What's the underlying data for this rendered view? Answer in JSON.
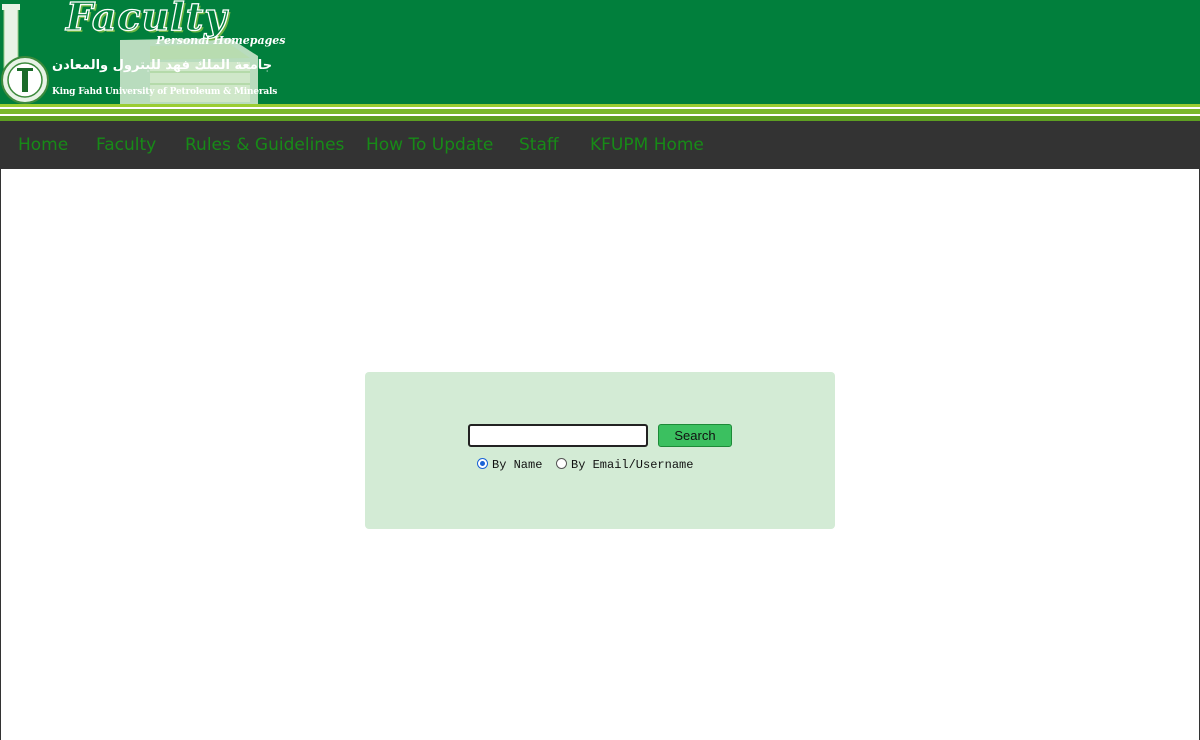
{
  "header": {
    "logo_title": "Faculty",
    "logo_subtitle": "Personal Homepages",
    "logo_arabic": "جامعة الملك فهد للبترول والمعادن",
    "logo_english": "King Fahd University of Petroleum & Minerals",
    "background_color": "#017f3c"
  },
  "nav": {
    "items": [
      {
        "label": "Home"
      },
      {
        "label": "Faculty"
      },
      {
        "label": "Rules & Guidelines"
      },
      {
        "label": "How To Update"
      },
      {
        "label": "Staff"
      },
      {
        "label": "KFUPM Home"
      }
    ],
    "background_color": "#333333",
    "link_color": "#178a17"
  },
  "search": {
    "input_value": "",
    "button_label": "Search",
    "options": [
      {
        "label": "By Name",
        "checked": true
      },
      {
        "label": "By Email/Username",
        "checked": false
      }
    ],
    "panel_color": "#d3ebd5",
    "button_color": "#3bc060"
  }
}
